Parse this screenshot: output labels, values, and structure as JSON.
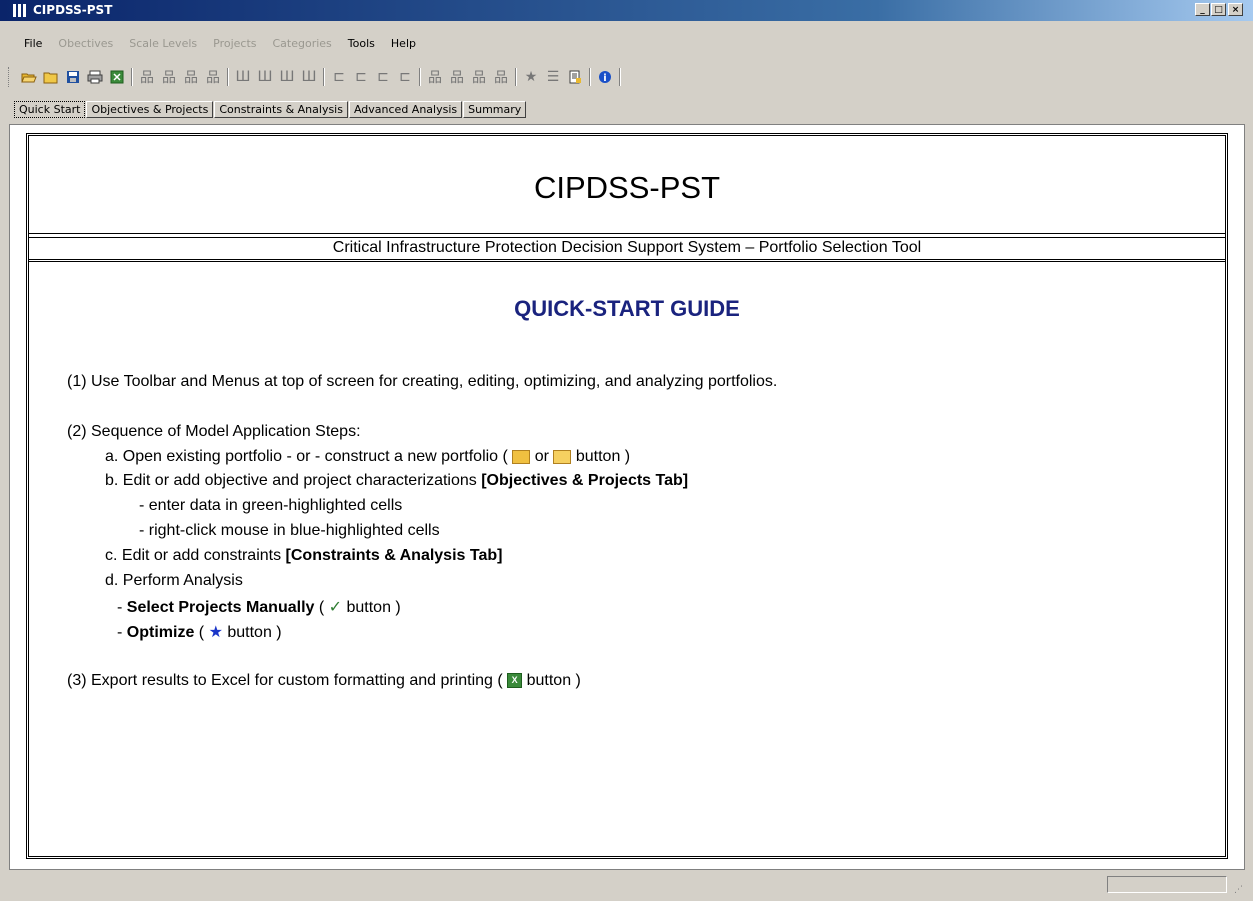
{
  "window": {
    "title": "CIPDSS-PST",
    "controls": {
      "minimize": "_",
      "maximize": "□",
      "close": "×"
    }
  },
  "menu": [
    {
      "label": "File",
      "enabled": true
    },
    {
      "label": "Obectives",
      "enabled": false
    },
    {
      "label": "Scale Levels",
      "enabled": false
    },
    {
      "label": "Projects",
      "enabled": false
    },
    {
      "label": "Categories",
      "enabled": false
    },
    {
      "label": "Tools",
      "enabled": true
    },
    {
      "label": "Help",
      "enabled": true
    }
  ],
  "toolbar": {
    "icons": [
      "open-icon",
      "new-folder-icon",
      "save-icon",
      "print-icon",
      "excel-icon",
      "add-objective-icon",
      "insert-objective-icon",
      "append-objective-icon",
      "delete-objective-icon",
      "add-project-icon",
      "insert-project-icon",
      "append-project-icon",
      "delete-project-icon",
      "add-constraint-icon",
      "insert-constraint-icon",
      "append-constraint-icon",
      "delete-constraint-icon",
      "add-category-icon",
      "insert-category-icon",
      "append-category-icon",
      "delete-category-icon",
      "star-icon",
      "list-icon",
      "report-icon",
      "info-icon"
    ]
  },
  "tabs": [
    "Quick Start",
    "Objectives & Projects",
    "Constraints & Analysis",
    "Advanced Analysis",
    "Summary"
  ],
  "content": {
    "title": "CIPDSS-PST",
    "subtitle": "Critical Infrastructure Protection Decision Support System – Portfolio Selection Tool",
    "guide_title": "QUICK-START GUIDE",
    "step1": "(1) Use Toolbar and Menus at top of screen for creating, editing, optimizing, and analyzing portfolios.",
    "step2": "(2) Sequence of Model Application Steps:",
    "step2a_pre": "a. Open existing portfolio  - or -  construct a new portfolio  ( ",
    "step2a_or": " or ",
    "step2a_post": " button )",
    "step2b": "b. Edit or add objective and project characterizations  ",
    "step2b_tab": "[Objectives & Projects Tab]",
    "step2b_i": "- enter data in green-highlighted cells",
    "step2b_ii": "- right-click mouse in blue-highlighted cells",
    "step2c": "c. Edit or add constraints  ",
    "step2c_tab": "[Constraints & Analysis Tab]",
    "step2d": "d. Perform Analysis",
    "step2d_manual": "Select Projects Manually",
    "step2d_manual_post": " button )",
    "step2d_opt": "Optimize",
    "step2d_opt_post": " button )",
    "step3_pre": "(3) Export results to Excel for custom formatting and printing ( ",
    "step3_post": "  button )"
  }
}
